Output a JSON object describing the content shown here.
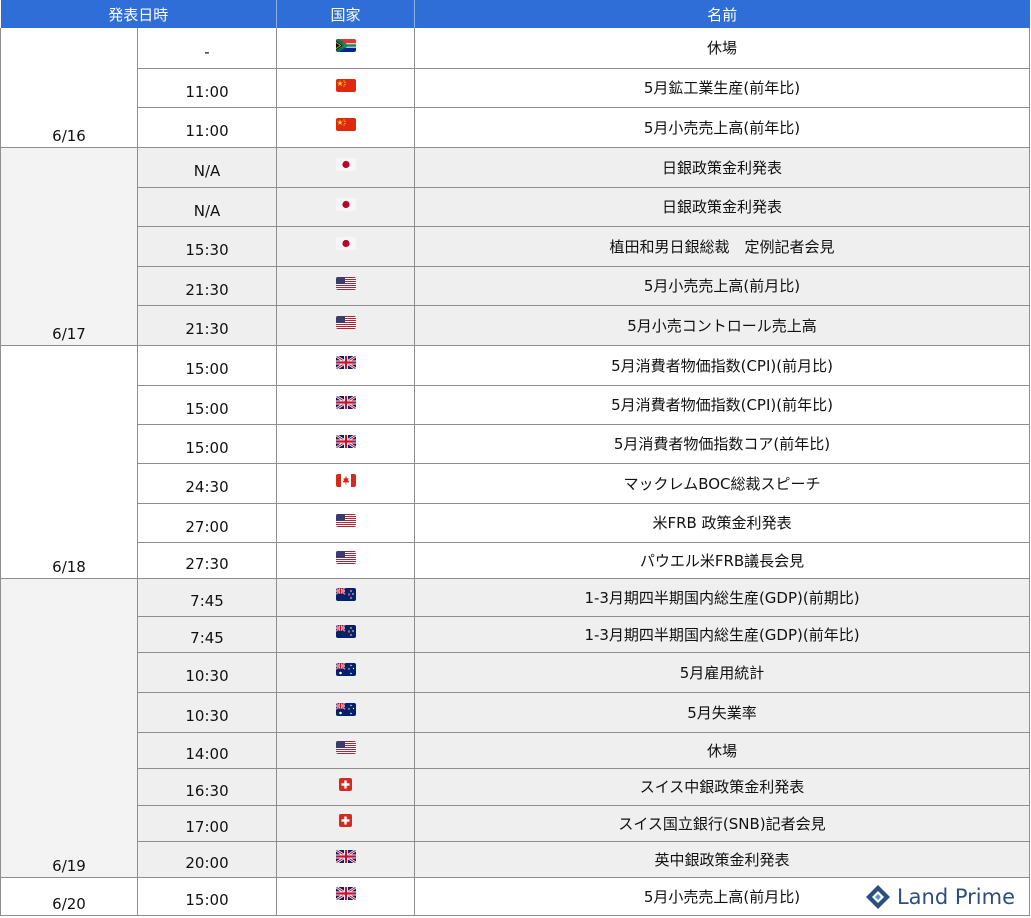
{
  "header": {
    "date": "発表日時",
    "country": "国家",
    "name": "名前"
  },
  "days": [
    {
      "date": "6/16",
      "shade": "white",
      "rows": [
        {
          "time": "-",
          "flag": "za-flag-icon",
          "name": "休場",
          "h": 40
        },
        {
          "time": "11:00",
          "flag": "cn-flag-icon",
          "name": "5月鉱工業生産(前年比)",
          "h": 39
        },
        {
          "time": "11:00",
          "flag": "cn-flag-icon",
          "name": "5月小売売上高(前年比)",
          "h": 40
        }
      ]
    },
    {
      "date": "6/17",
      "shade": "grey",
      "rows": [
        {
          "time": "N/A",
          "flag": "jp-flag-icon",
          "name": "日銀政策金利発表",
          "h": 40
        },
        {
          "time": "N/A",
          "flag": "jp-flag-icon",
          "name": "日銀政策金利発表",
          "h": 39
        },
        {
          "time": "15:30",
          "flag": "jp-flag-icon",
          "name": "植田和男日銀総裁　定例記者会見",
          "h": 40
        },
        {
          "time": "21:30",
          "flag": "us-flag-icon",
          "name": "5月小売売上高(前月比)",
          "h": 39
        },
        {
          "time": "21:30",
          "flag": "us-flag-icon",
          "name": "5月小売コントロール売上高",
          "h": 40
        }
      ]
    },
    {
      "date": "6/18",
      "shade": "white",
      "rows": [
        {
          "time": "15:00",
          "flag": "uk-flag-icon",
          "name": "5月消費者物価指数(CPI)(前月比)",
          "h": 40
        },
        {
          "time": "15:00",
          "flag": "uk-flag-icon",
          "name": "5月消費者物価指数(CPI)(前年比)",
          "h": 39
        },
        {
          "time": "15:00",
          "flag": "uk-flag-icon",
          "name": "5月消費者物価指数コア(前年比)",
          "h": 39
        },
        {
          "time": "24:30",
          "flag": "ca-flag-icon",
          "name": "マックレムBOC総裁スピーチ",
          "h": 40
        },
        {
          "time": "27:00",
          "flag": "us-flag-icon",
          "name": "米FRB 政策金利発表",
          "h": 39
        },
        {
          "time": "27:30",
          "flag": "us-flag-icon",
          "name": "パウエル米FRB議長会見",
          "h": 36
        }
      ]
    },
    {
      "date": "6/19",
      "shade": "grey",
      "rows": [
        {
          "time": "7:45",
          "flag": "nz-flag-icon",
          "name": "1-3月期四半期国内総生産(GDP)(前期比)",
          "h": 38
        },
        {
          "time": "7:45",
          "flag": "nz-flag-icon",
          "name": "1-3月期四半期国内総生産(GDP)(前年比)",
          "h": 36
        },
        {
          "time": "10:30",
          "flag": "au-flag-icon",
          "name": "5月雇用統計",
          "h": 40
        },
        {
          "time": "10:30",
          "flag": "au-flag-icon",
          "name": "5月失業率",
          "h": 40
        },
        {
          "time": "14:00",
          "flag": "us-flag-icon",
          "name": "休場",
          "h": 36
        },
        {
          "time": "16:30",
          "flag": "ch-flag-icon",
          "name": "スイス中銀政策金利発表",
          "h": 37
        },
        {
          "time": "17:00",
          "flag": "ch-flag-icon",
          "name": "スイス国立銀行(SNB)記者会見",
          "h": 36
        },
        {
          "time": "20:00",
          "flag": "uk-flag-icon",
          "name": "英中銀政策金利発表",
          "h": 36
        }
      ]
    },
    {
      "date": "6/20",
      "shade": "white",
      "rows": [
        {
          "time": "15:00",
          "flag": "uk-flag-icon",
          "name": "5月小売売上高(前月比)",
          "h": 38
        }
      ]
    }
  ],
  "brand": {
    "name": "Land Prime",
    "logo": "land-prime-logo-icon",
    "color": "#2b4f7e"
  },
  "colors": {
    "header_bg": "#2f6ed6",
    "grey_row": "#efefef"
  }
}
